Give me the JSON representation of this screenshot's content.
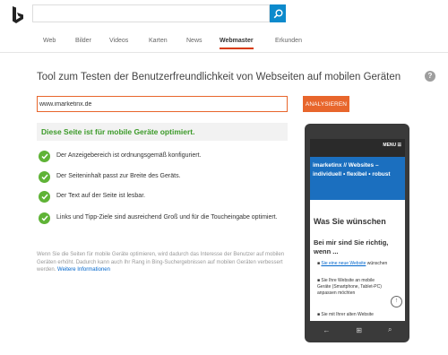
{
  "header": {
    "search_value": "",
    "tabs": [
      {
        "label": "Web"
      },
      {
        "label": "Bilder"
      },
      {
        "label": "Videos"
      },
      {
        "label": "Karten"
      },
      {
        "label": "News"
      },
      {
        "label": "Webmaster",
        "active": true
      },
      {
        "label": "Erkunden"
      }
    ]
  },
  "main": {
    "title": "Tool zum Testen der Benutzerfreundlichkeit von Webseiten auf mobilen Geräten",
    "help_label": "?",
    "url_value": "www.imarketinx.de",
    "analyze_label": "ANALYSIEREN",
    "result": "Diese Seite ist für mobile Geräte optimiert.",
    "checks": [
      "Der Anzeigebereich ist ordnungsgemäß konfiguriert.",
      "Der Seiteninhalt passt zur Breite des Geräts.",
      "Der Text auf der Seite ist lesbar.",
      "Links und Tipp-Ziele sind ausreichend Groß und für die Toucheingabe optimiert."
    ],
    "note": "Wenn Sie die Seiten für mobile Geräte optimieren, wird dadurch das Interesse der Benutzer auf mobilen Geräten erhöht. Dadurch kann auch Ihr Rang in Bing-Suchergebnissen auf mobilen Geräten verbessert werden.",
    "note_link": "Weitere Informationen"
  },
  "phone": {
    "menu": "MENU ☰",
    "banner": "imarketinx // Websites – individuell • flexibel • robust",
    "heading": "Was Sie wünschen",
    "subheading": "Bei mir sind Sie richtig, wenn ...",
    "items": [
      {
        "link": "Sie eine neue Website",
        "rest": " wünschen"
      },
      {
        "link": "",
        "rest": "Sie Ihre Website an mobile Geräte (Smartphone, Tablet-PC) anpassen möchten"
      },
      {
        "link": "",
        "rest": "Sie mit Ihrer alten Website"
      }
    ]
  },
  "colors": {
    "accent": "#e8662c",
    "success": "#3c9a29",
    "brand": "#0c8acc"
  }
}
